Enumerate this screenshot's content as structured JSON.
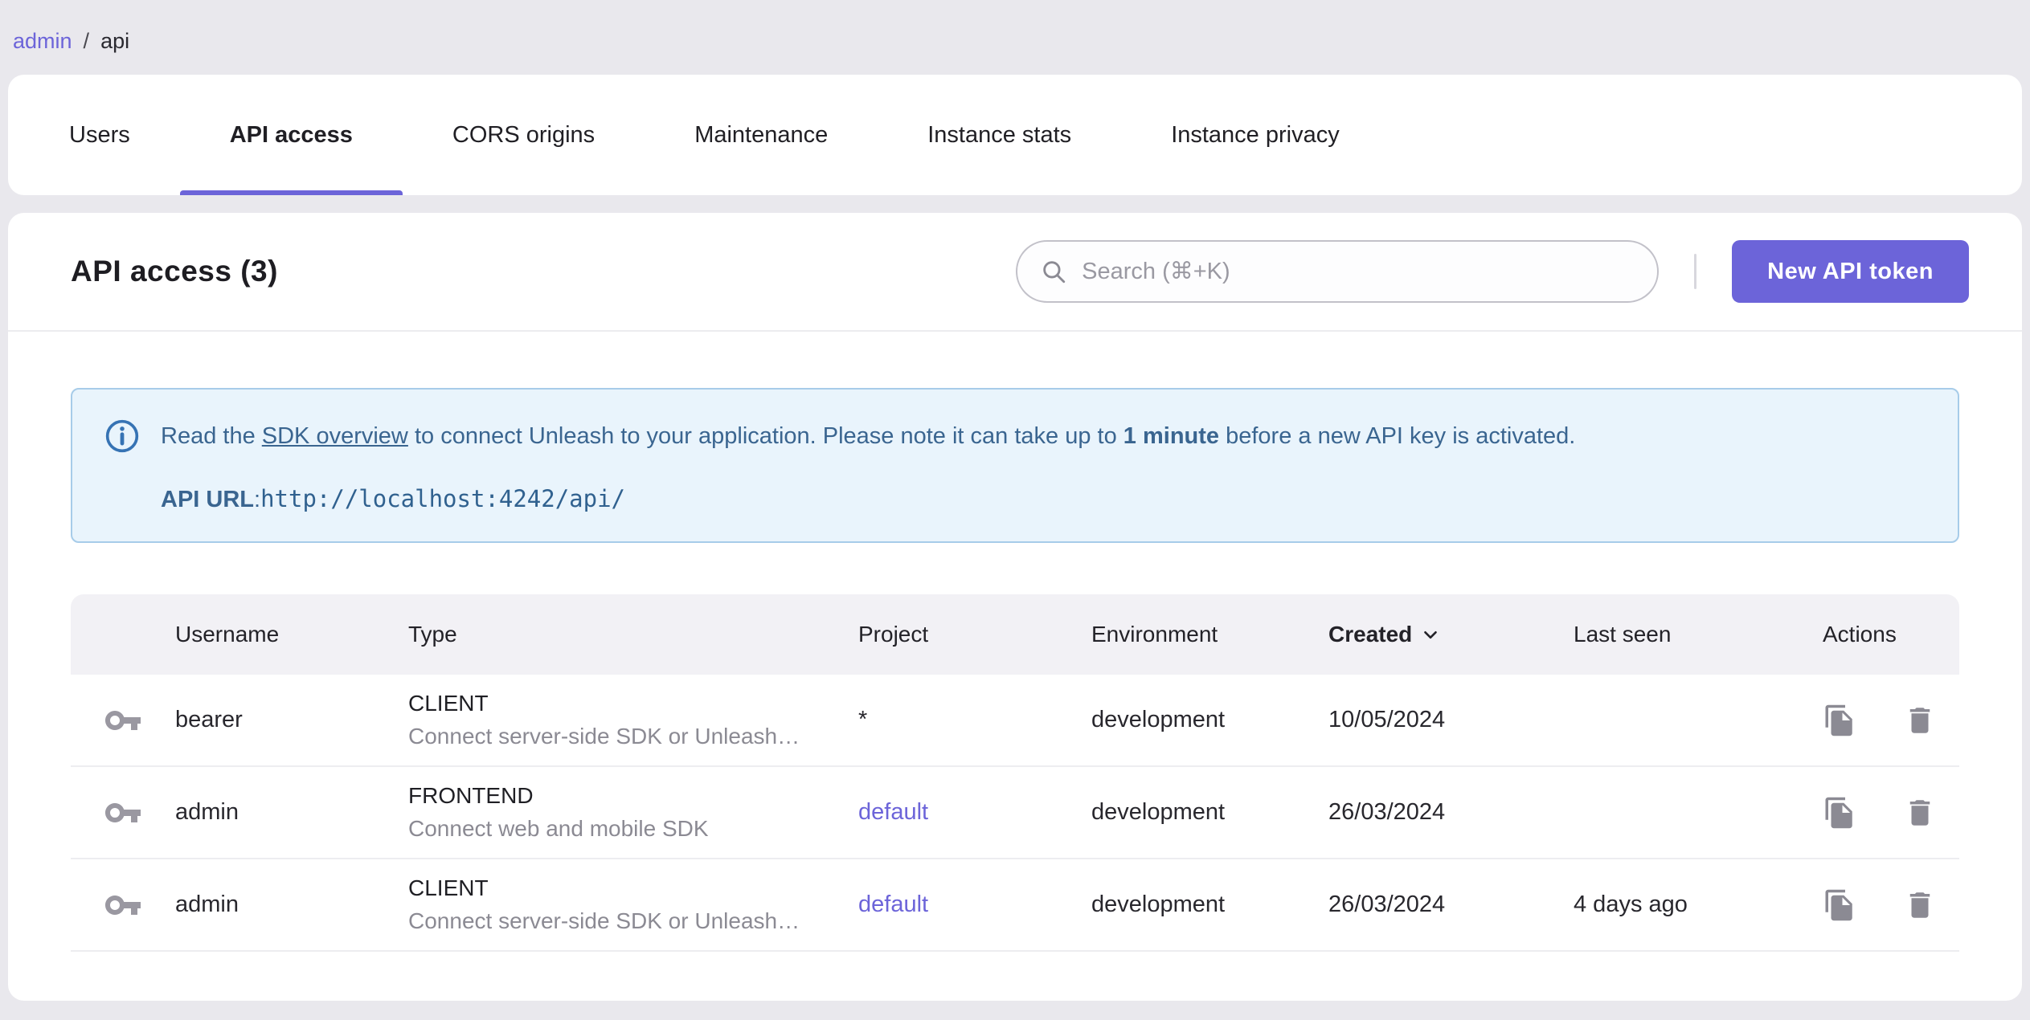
{
  "breadcrumb": {
    "items": [
      "admin",
      "api"
    ],
    "separator": "/"
  },
  "tabs": [
    {
      "label": "Users"
    },
    {
      "label": "API access"
    },
    {
      "label": "CORS origins"
    },
    {
      "label": "Maintenance"
    },
    {
      "label": "Instance stats"
    },
    {
      "label": "Instance privacy"
    }
  ],
  "active_tab": "API access",
  "toolbar": {
    "title": "API access (3)",
    "search_placeholder": "Search (⌘+K)",
    "new_token_label": "New API token"
  },
  "info_banner": {
    "text_before_link": "Read the ",
    "link_text": "SDK overview",
    "text_after_link": " to connect Unleash to your application. Please note it can take up to ",
    "bold_text": "1 minute",
    "text_end": " before a new API key is activated.",
    "api_url_label": "API URL",
    "api_url_separator": ": ",
    "api_url": "http://localhost:4242/api/"
  },
  "table": {
    "columns": [
      "Username",
      "Type",
      "Project",
      "Environment",
      "Created",
      "Last seen",
      "Actions"
    ],
    "sorted_column": "Created",
    "rows": [
      {
        "username": "bearer",
        "type": "CLIENT",
        "type_description": "Connect server-side SDK or Unleash…",
        "project": "*",
        "project_is_link": false,
        "environment": "development",
        "created": "10/05/2024",
        "last_seen": ""
      },
      {
        "username": "admin",
        "type": "FRONTEND",
        "type_description": "Connect web and mobile SDK",
        "project": "default",
        "project_is_link": true,
        "environment": "development",
        "created": "26/03/2024",
        "last_seen": ""
      },
      {
        "username": "admin",
        "type": "CLIENT",
        "type_description": "Connect server-side SDK or Unleash…",
        "project": "default",
        "project_is_link": true,
        "environment": "development",
        "created": "26/03/2024",
        "last_seen": "4 days ago"
      }
    ]
  },
  "icons": {
    "search": "magnifier",
    "info": "info-circle",
    "key": "key",
    "copy": "copy-file",
    "delete": "trash-can",
    "sort": "chevron-down"
  },
  "colors": {
    "primary": "#6c64d9",
    "page_background": "#e9e8ed",
    "info_background": "#e9f4fc",
    "info_border": "#a7cce9",
    "info_text": "#3a6590",
    "info_icon": "#3673b4",
    "muted_icon": "#8b8a93"
  }
}
